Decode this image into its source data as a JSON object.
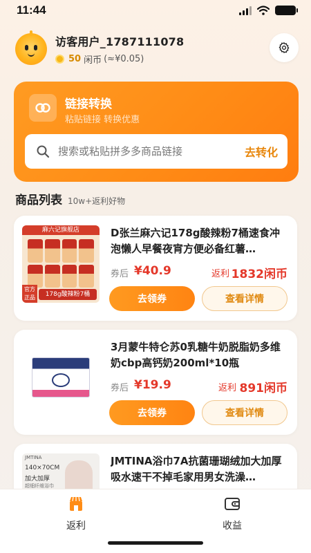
{
  "status_bar": {
    "time": "11:44"
  },
  "profile": {
    "username": "访客用户_1787111078",
    "coin_count": "50",
    "coin_unit": "闲币",
    "coin_value": "(≈¥0.05)"
  },
  "converter": {
    "title": "链接转换",
    "subtitle": "粘贴链接 转换优惠",
    "search_placeholder": "搜索或粘贴拼多多商品链接",
    "convert_button": "去转化"
  },
  "product_list": {
    "title": "商品列表",
    "subtitle": "10w+返利好物",
    "items": [
      {
        "title": "D张兰麻六记178g酸辣粉7桶速食冲泡懒人早餐夜宵方便必备红薯…",
        "price_label": "券后",
        "price": "¥40.9",
        "rebate_label": "返利",
        "rebate": "1832闲币",
        "coupon_button": "去领券",
        "detail_button": "查看详情",
        "thumb_banner": "麻六记旗舰店",
        "thumb_tag": "官方正品",
        "thumb_caption": "178g酸辣粉7桶"
      },
      {
        "title": "3月蒙牛特仑苏0乳糖牛奶脱脂奶多维奶cbp高钙奶200ml*10瓶",
        "price_label": "券后",
        "price": "¥19.9",
        "rebate_label": "返利",
        "rebate": "891闲币",
        "coupon_button": "去领券",
        "detail_button": "查看详情"
      },
      {
        "title": "JMTINA浴巾7A抗菌珊瑚绒加大加厚吸水速干不掉毛家用男女洗澡…",
        "thumb_brand": "JMTINA",
        "thumb_size": "140×70CM",
        "thumb_caption": "加大加厚",
        "thumb_small": "超细纤维浴巾"
      }
    ]
  },
  "tabbar": {
    "tabs": [
      {
        "label": "返利",
        "icon": "shop-icon",
        "active": true
      },
      {
        "label": "收益",
        "icon": "wallet-icon",
        "active": false
      }
    ]
  },
  "colors": {
    "accent": "#ff8c16",
    "price": "#e4382a",
    "coin": "#d68a00"
  }
}
